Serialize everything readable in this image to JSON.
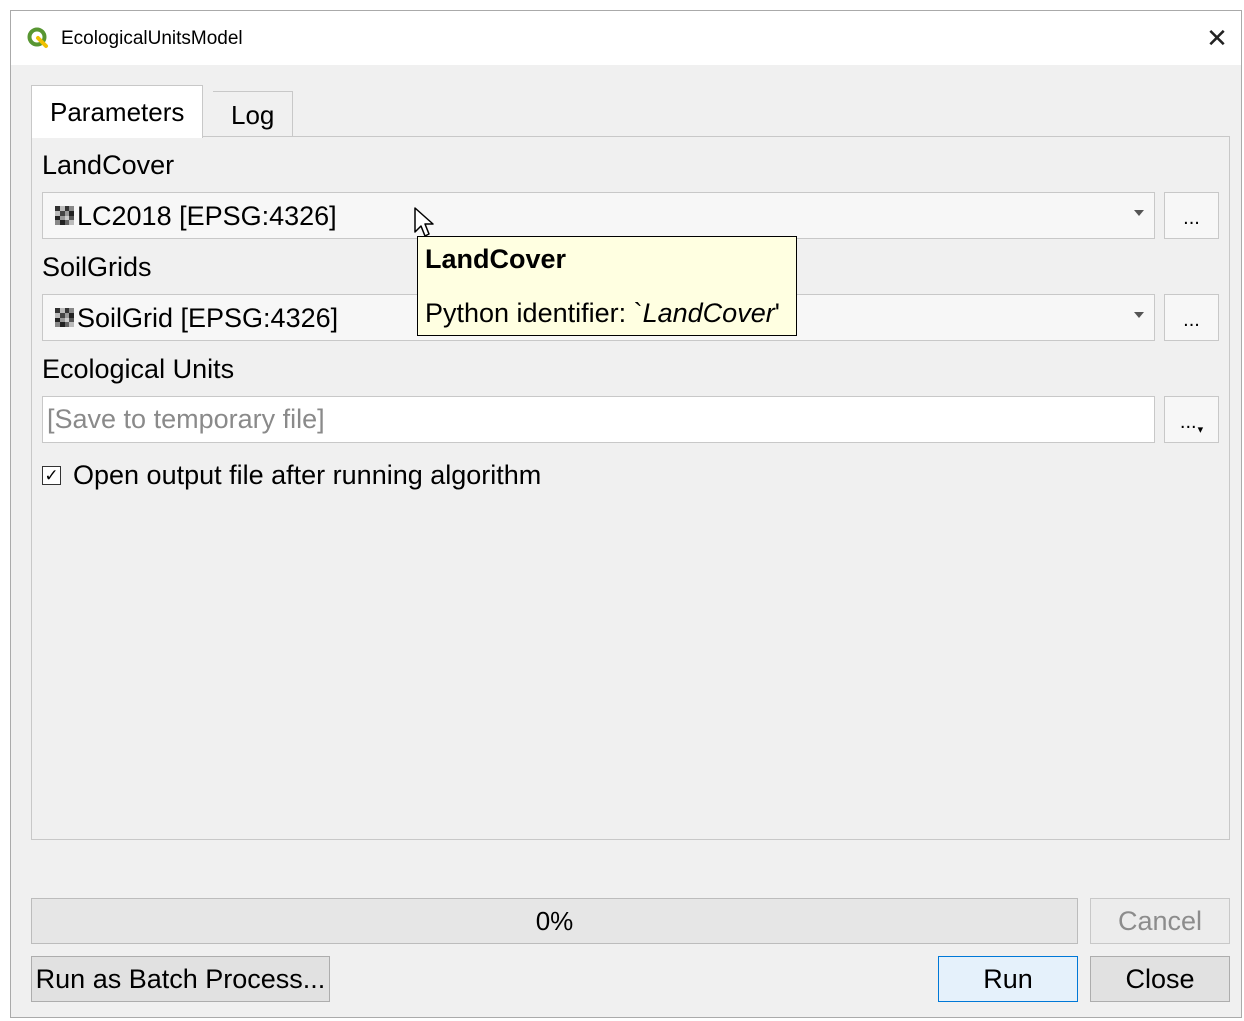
{
  "window": {
    "title": "EcologicalUnitsModel",
    "close_glyph": "✕"
  },
  "tabs": [
    {
      "label": "Parameters",
      "active": true
    },
    {
      "label": "Log",
      "active": false
    }
  ],
  "params": {
    "landcover": {
      "label": "LandCover",
      "value": "LC2018 [EPSG:4326]",
      "browse_label": "..."
    },
    "soilgrids": {
      "label": "SoilGrids",
      "value": "SoilGrid [EPSG:4326]",
      "browse_label": "..."
    },
    "ecological_units": {
      "label": "Ecological Units",
      "placeholder": "[Save to temporary file]",
      "browse_label": "..."
    },
    "open_output": {
      "label": "Open output file after running algorithm",
      "checked": true,
      "check_glyph": "✓"
    }
  },
  "tooltip": {
    "title": "LandCover",
    "prefix": "Python identifier: `",
    "identifier": "LandCover",
    "suffix": "'"
  },
  "progress": {
    "value": 0,
    "text": "0%"
  },
  "buttons": {
    "cancel": "Cancel",
    "batch": "Run as Batch Process...",
    "run": "Run",
    "close": "Close"
  },
  "colors": {
    "tooltip_bg": "#ffffe1",
    "run_border": "#0078d7",
    "qgis_green": "#589632",
    "qgis_yellow": "#f0c000"
  },
  "icons": {
    "app": "qgis-logo-icon",
    "raster": "raster-layer-icon",
    "dropdown": "chevron-down-icon",
    "cursor": "mouse-pointer-icon"
  }
}
